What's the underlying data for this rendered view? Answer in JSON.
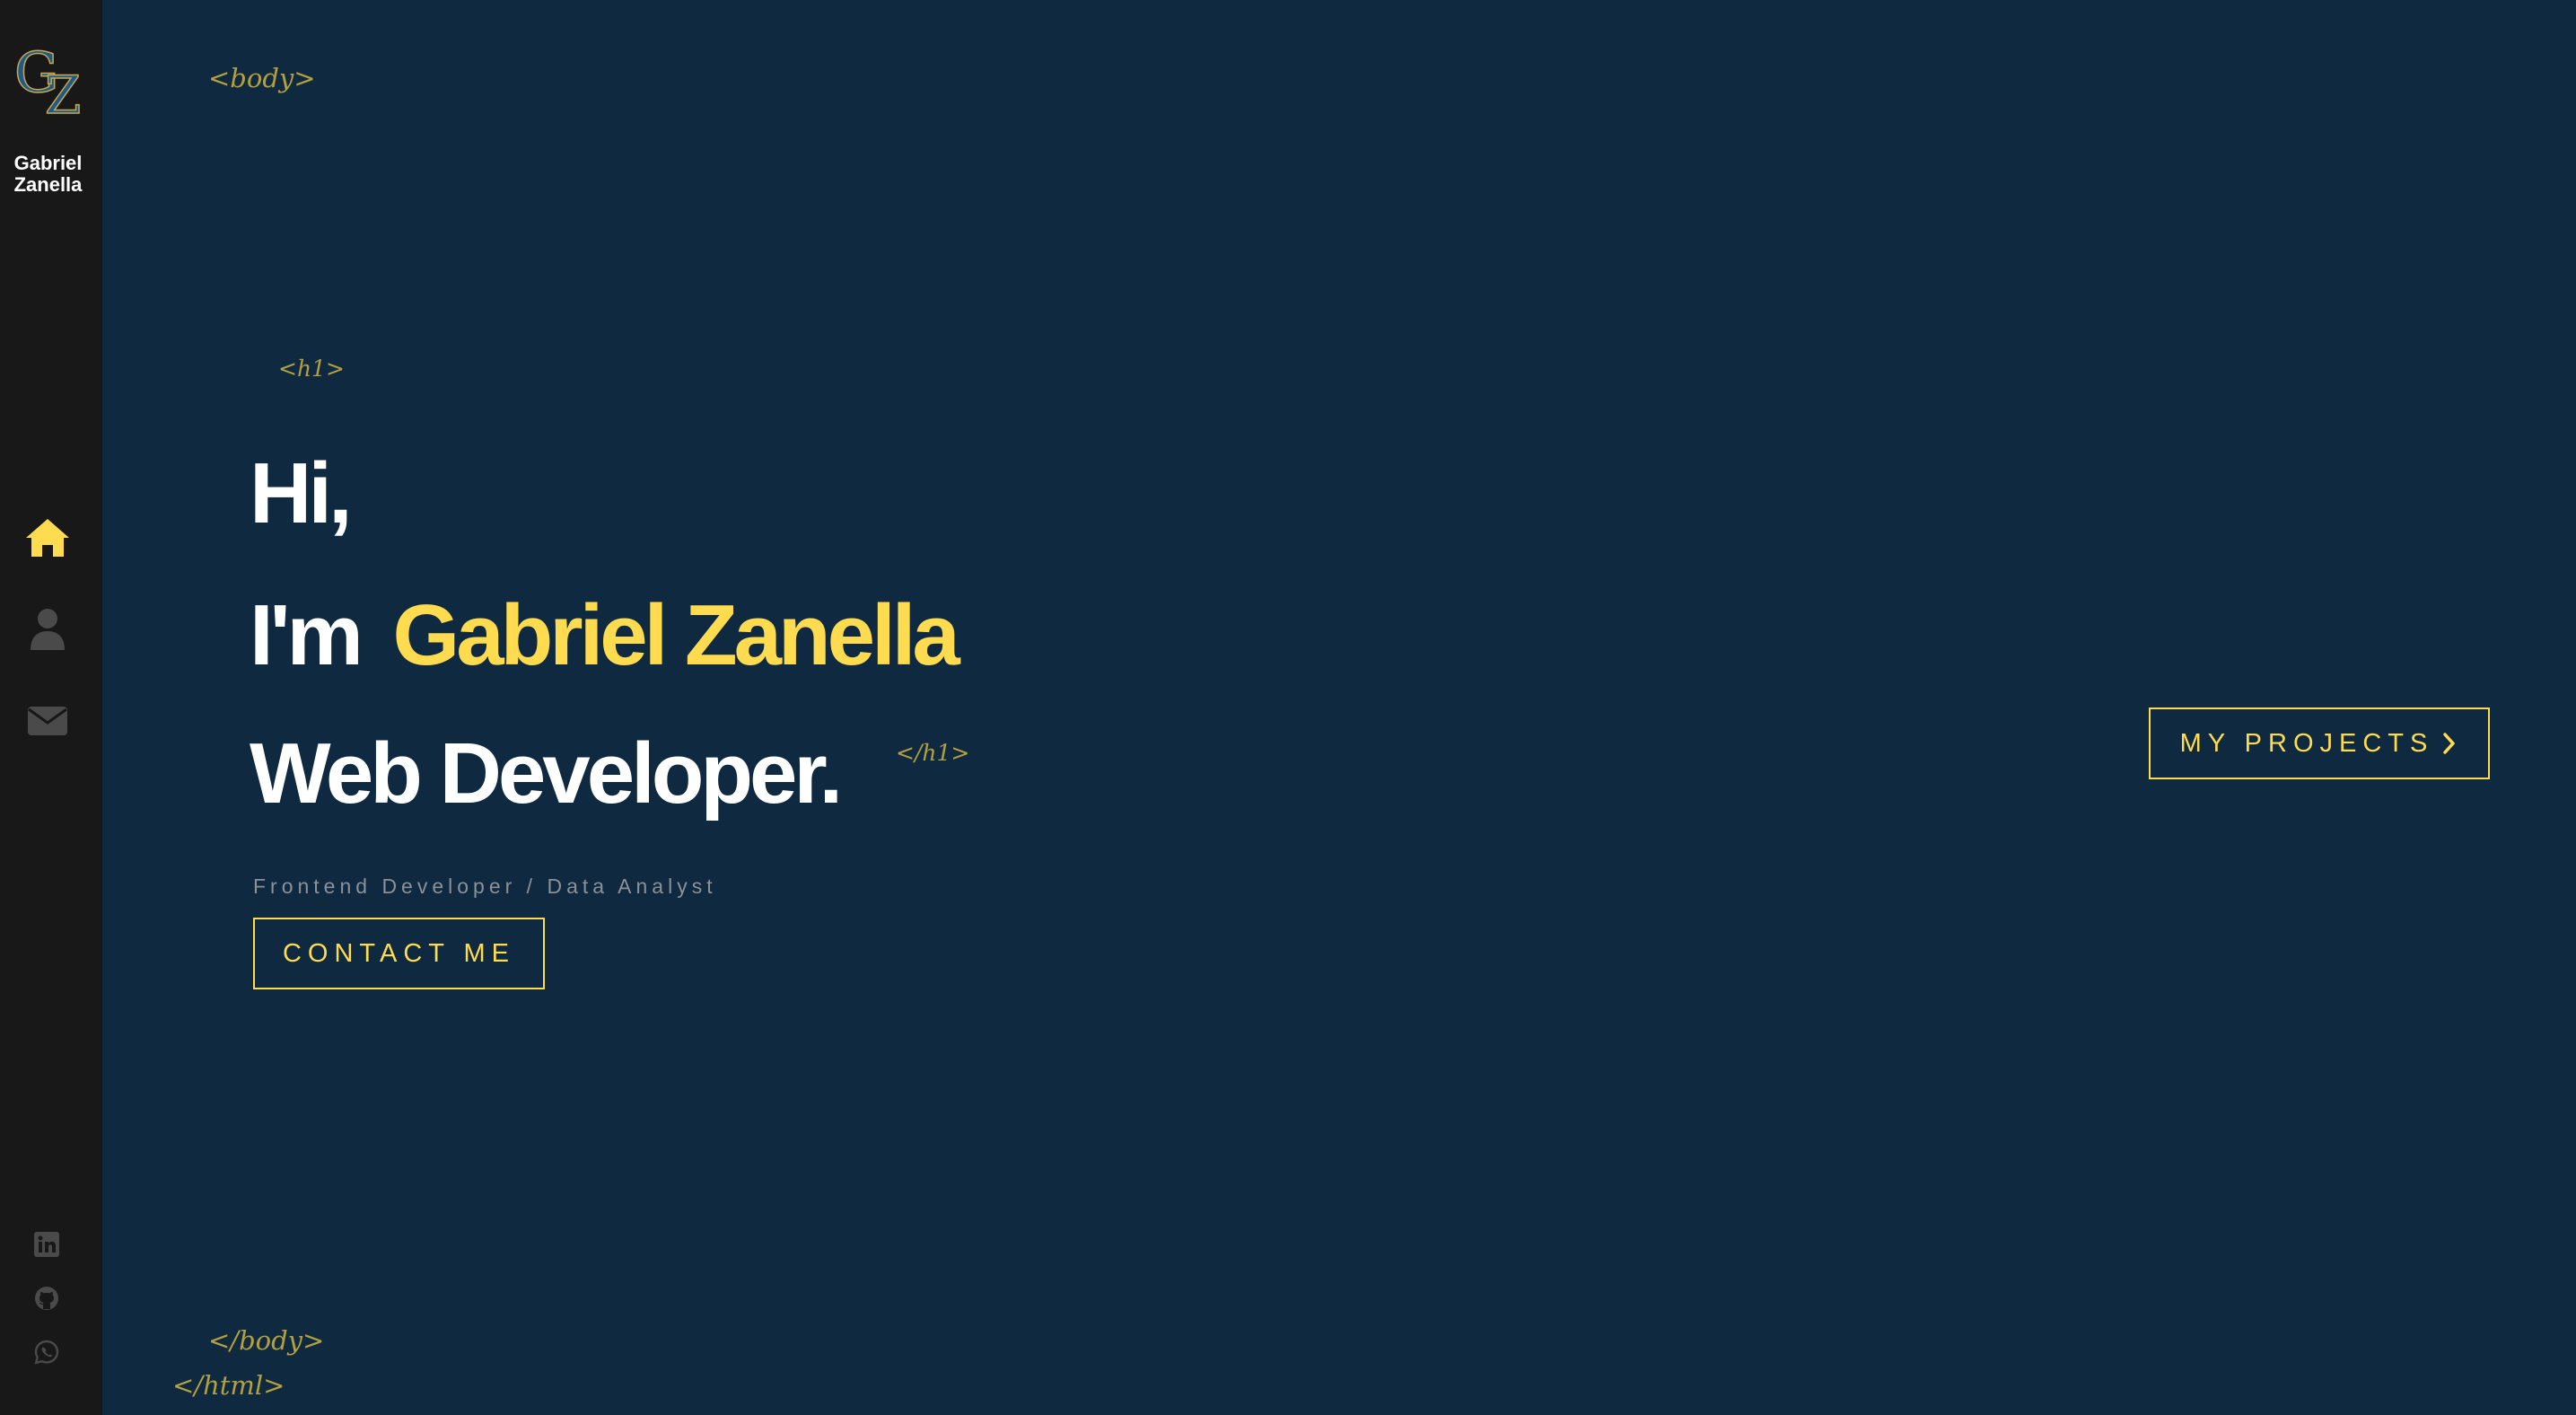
{
  "brand": {
    "logo_letters": "GZ",
    "name": "Gabriel\nZanella"
  },
  "nav": {
    "items": [
      {
        "icon": "home-icon",
        "active": true
      },
      {
        "icon": "user-icon",
        "active": false
      },
      {
        "icon": "envelope-icon",
        "active": false
      }
    ]
  },
  "social": {
    "items": [
      {
        "icon": "linkedin-icon"
      },
      {
        "icon": "github-icon"
      },
      {
        "icon": "whatsapp-icon"
      }
    ]
  },
  "tags": {
    "body_open": "<body>",
    "h1_open": "<h1>",
    "h1_close": "</h1>",
    "body_close": "</body>",
    "html_close": "</html>"
  },
  "hero": {
    "line1": "Hi,",
    "line2_prefix": "I'm",
    "line2_name": "Gabriel Zanella",
    "line3": "Web Developer.",
    "subtitle": "Frontend Developer / Data Analyst"
  },
  "buttons": {
    "contact": "CONTACT ME",
    "projects": "MY PROJECTS"
  },
  "colors": {
    "background": "#0f2940",
    "sidebar": "#181818",
    "accent": "#ffdb50",
    "tag": "#b3a03f",
    "icon_inactive": "#4a4a4a"
  }
}
